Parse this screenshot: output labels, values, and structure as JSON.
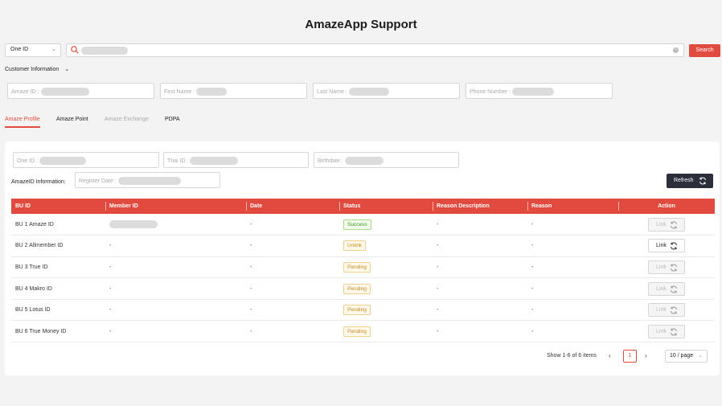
{
  "app": {
    "title": "AmazeApp Support"
  },
  "search": {
    "type_select": "One ID",
    "button_label": "Search"
  },
  "customer_info": {
    "label": "Customer Information",
    "fields": [
      {
        "placeholder": "Amaze ID :"
      },
      {
        "placeholder": "First Name :"
      },
      {
        "placeholder": "Last Name :"
      },
      {
        "placeholder": "Phone Number :"
      }
    ]
  },
  "tabs": [
    {
      "label": "Amaze Profile",
      "state": "active"
    },
    {
      "label": "Amaze Point",
      "state": "normal"
    },
    {
      "label": "Amaze Exchange",
      "state": "disabled"
    },
    {
      "label": "PDPA",
      "state": "normal"
    }
  ],
  "profile": {
    "fields": [
      {
        "placeholder": "One ID :"
      },
      {
        "placeholder": "Thai ID :"
      },
      {
        "placeholder": "Birthdate :"
      }
    ],
    "amazeid_label": "AmazeID Information:",
    "register_date_placeholder": "Register Date :",
    "refresh_label": "Refresh"
  },
  "table": {
    "columns": [
      "BU ID",
      "Member ID",
      "Date",
      "Status",
      "Reason Description",
      "Reason",
      "Action"
    ],
    "rows": [
      {
        "bu_id": "BU 1 Amaze ID",
        "member_id": "",
        "date": "-",
        "status": "Success",
        "status_type": "success",
        "reason_desc": "-",
        "reason": "-",
        "action": "Link",
        "action_enabled": false
      },
      {
        "bu_id": "BU 2 Allmember ID",
        "member_id": "-",
        "date": "-",
        "status": "Unlink",
        "status_type": "unlink",
        "reason_desc": "-",
        "reason": "-",
        "action": "Link",
        "action_enabled": true
      },
      {
        "bu_id": "BU 3 True ID",
        "member_id": "-",
        "date": "-",
        "status": "Pending",
        "status_type": "pending",
        "reason_desc": "-",
        "reason": "-",
        "action": "Link",
        "action_enabled": false
      },
      {
        "bu_id": "BU 4 Makro ID",
        "member_id": "-",
        "date": "-",
        "status": "Pending",
        "status_type": "pending",
        "reason_desc": "-",
        "reason": "-",
        "action": "Link",
        "action_enabled": false
      },
      {
        "bu_id": "BU 5 Lotus ID",
        "member_id": "-",
        "date": "-",
        "status": "Pending",
        "status_type": "pending",
        "reason_desc": "-",
        "reason": "-",
        "action": "Link",
        "action_enabled": false
      },
      {
        "bu_id": "BU 6 True Money ID",
        "member_id": "-",
        "date": "-",
        "status": "Pending",
        "status_type": "pending",
        "reason_desc": "-",
        "reason": "-",
        "action": "Link",
        "action_enabled": false
      }
    ]
  },
  "pagination": {
    "summary": "Show 1-6 of 6 items",
    "current_page": "1",
    "prev": "‹",
    "next": "›",
    "page_size": "10 / page"
  },
  "colors": {
    "accent": "#e14a3e",
    "dark_button": "#2b2f3a"
  }
}
